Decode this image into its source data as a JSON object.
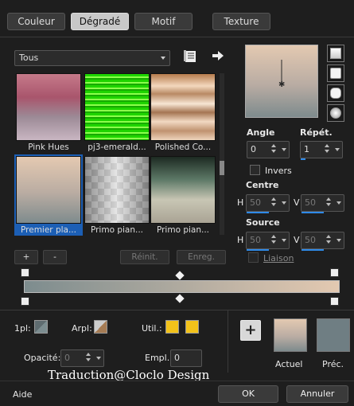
{
  "tabs": [
    {
      "label": "Couleur"
    },
    {
      "label": "Dégradé",
      "active": true
    },
    {
      "label": "Motif"
    },
    {
      "label": "Texture"
    }
  ],
  "filter": {
    "value": "Tous"
  },
  "gradients": [
    {
      "name": "Pink Hues"
    },
    {
      "name": "pj3-emerald..."
    },
    {
      "name": "Polished Co..."
    },
    {
      "name": "Premier pla...",
      "selected": true
    },
    {
      "name": "Primo pian..."
    },
    {
      "name": "Primo pian..."
    }
  ],
  "list_buttons": {
    "add": "+",
    "remove": "-",
    "reset": "Réinit.",
    "save": "Enreg."
  },
  "angle": {
    "label": "Angle",
    "value": "0"
  },
  "repeat": {
    "label": "Répét.",
    "value": "1"
  },
  "invert": {
    "label": "Invers"
  },
  "center": {
    "label": "Centre",
    "h_label": "H",
    "h_value": "50",
    "v_label": "V",
    "v_value": "50"
  },
  "source": {
    "label": "Source",
    "h_label": "H",
    "h_value": "50",
    "v_label": "V",
    "v_value": "50"
  },
  "link": {
    "label": "Liaison"
  },
  "gradient_editor": {
    "start_color": "#7d8c8e",
    "end_color": "#e3c9b1"
  },
  "bottom": {
    "pl_label": "1pl:",
    "arpl_label": "Arpl:",
    "util_label": "Util.:",
    "util_color": "#f2c21a",
    "opacity_label": "Opacité:",
    "opacity_value": "0",
    "empl_label": "Empl.:",
    "empl_value": "0",
    "add_label": "+",
    "current_label": "Actuel",
    "prev_label": "Préc."
  },
  "credit": "Traduction@Cloclo Design",
  "footer": {
    "help": "Aide",
    "ok": "OK",
    "cancel": "Annuler"
  }
}
